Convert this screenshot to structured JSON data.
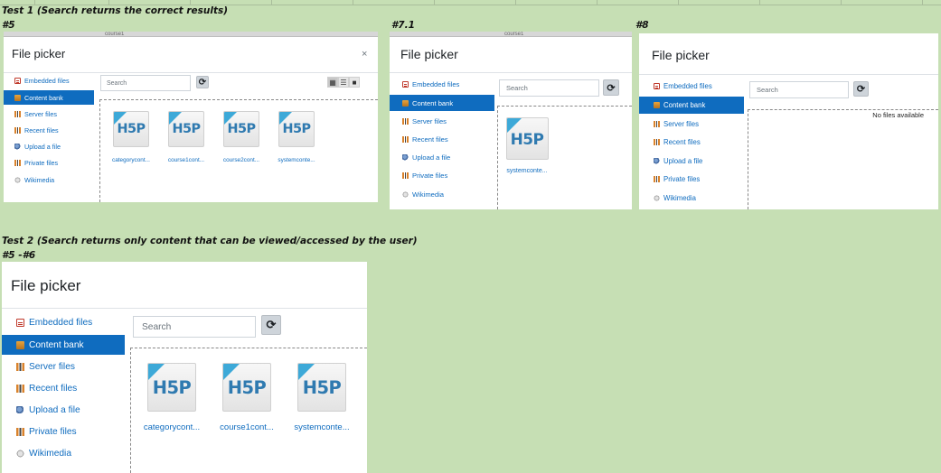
{
  "test1": {
    "heading": "Test 1 (Search returns the correct results)",
    "label_5": "#5",
    "label_71": "#7.1",
    "label_8": "#8",
    "strip_5": "course1",
    "strip_71": "course1"
  },
  "test2": {
    "heading": "Test 2 (Search returns only content that can be viewed/accessed by the user)",
    "label": "#5 -#6"
  },
  "file_picker": {
    "title": "File picker",
    "close": "×",
    "search_placeholder": "Search",
    "refresh_icon": "⟳",
    "no_files": "No files available",
    "sidebar": [
      {
        "label": "Embedded files",
        "icon": "embedded-files-icon"
      },
      {
        "label": "Content bank",
        "icon": "content-bank-icon"
      },
      {
        "label": "Server files",
        "icon": "server-files-icon"
      },
      {
        "label": "Recent files",
        "icon": "recent-files-icon"
      },
      {
        "label": "Upload a file",
        "icon": "upload-icon"
      },
      {
        "label": "Private files",
        "icon": "private-files-icon"
      },
      {
        "label": "Wikimedia",
        "icon": "wikimedia-icon"
      }
    ],
    "view_buttons": [
      "▦",
      "☰",
      "■"
    ]
  },
  "h5p_logo": "H5P",
  "shot5_files": [
    "categorycont...",
    "course1cont...",
    "course2cont...",
    "systemconte..."
  ],
  "shot71_files": [
    "systemconte..."
  ],
  "test2_files": [
    "categorycont...",
    "course1cont...",
    "systemconte..."
  ],
  "colors": {
    "link": "#0f6cbf",
    "active_bg": "#0f6cbf",
    "page_bg": "#c6dfb4"
  }
}
